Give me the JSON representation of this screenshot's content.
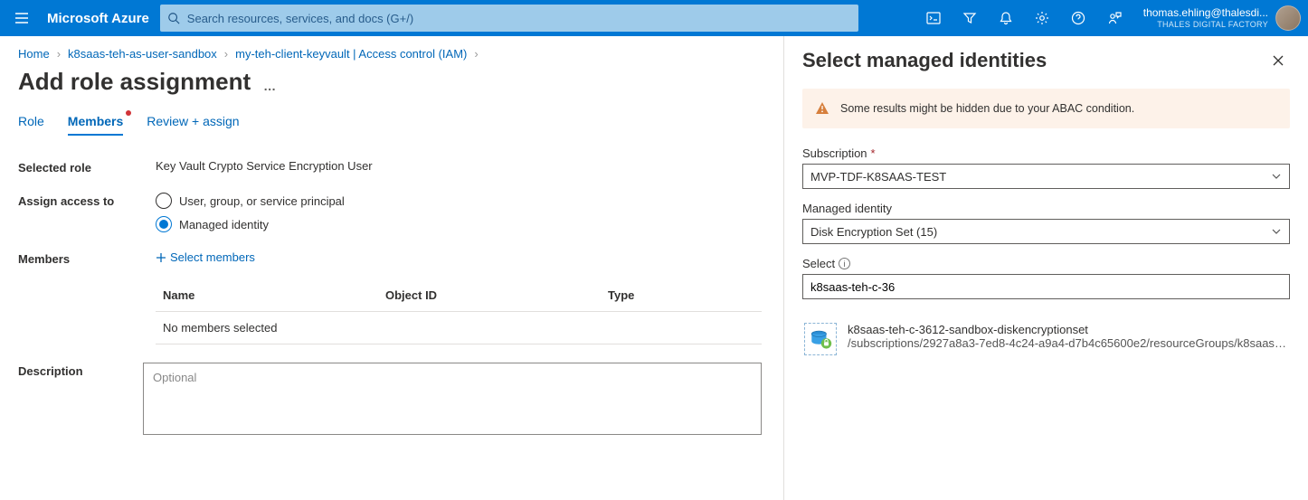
{
  "header": {
    "brand": "Microsoft Azure",
    "search_placeholder": "Search resources, services, and docs (G+/)",
    "account_email": "thomas.ehling@thalesdi...",
    "account_org": "THALES DIGITAL FACTORY"
  },
  "breadcrumbs": {
    "items": [
      "Home",
      "k8saas-teh-as-user-sandbox",
      "my-teh-client-keyvault | Access control (IAM)"
    ]
  },
  "page": {
    "title": "Add role assignment"
  },
  "tabs": {
    "role": "Role",
    "members": "Members",
    "review": "Review + assign"
  },
  "form": {
    "selected_role_label": "Selected role",
    "selected_role_value": "Key Vault Crypto Service Encryption User",
    "assign_access_label": "Assign access to",
    "radio_user": "User, group, or service principal",
    "radio_mi": "Managed identity",
    "members_label": "Members",
    "select_members": "Select members",
    "table_name": "Name",
    "table_object": "Object ID",
    "table_type": "Type",
    "table_empty": "No members selected",
    "description_label": "Description",
    "description_placeholder": "Optional"
  },
  "panel": {
    "title": "Select managed identities",
    "warning": "Some results might be hidden due to your ABAC condition.",
    "subscription_label": "Subscription",
    "subscription_value": "MVP-TDF-K8SAAS-TEST",
    "mi_label": "Managed identity",
    "mi_value": "Disk Encryption Set (15)",
    "select_label": "Select",
    "select_value": "k8saas-teh-c-36",
    "result_name": "k8saas-teh-c-3612-sandbox-diskencryptionset",
    "result_sub": "/subscriptions/2927a8a3-7ed8-4c24-a9a4-d7b4c65600e2/resourceGroups/k8saas-..."
  }
}
